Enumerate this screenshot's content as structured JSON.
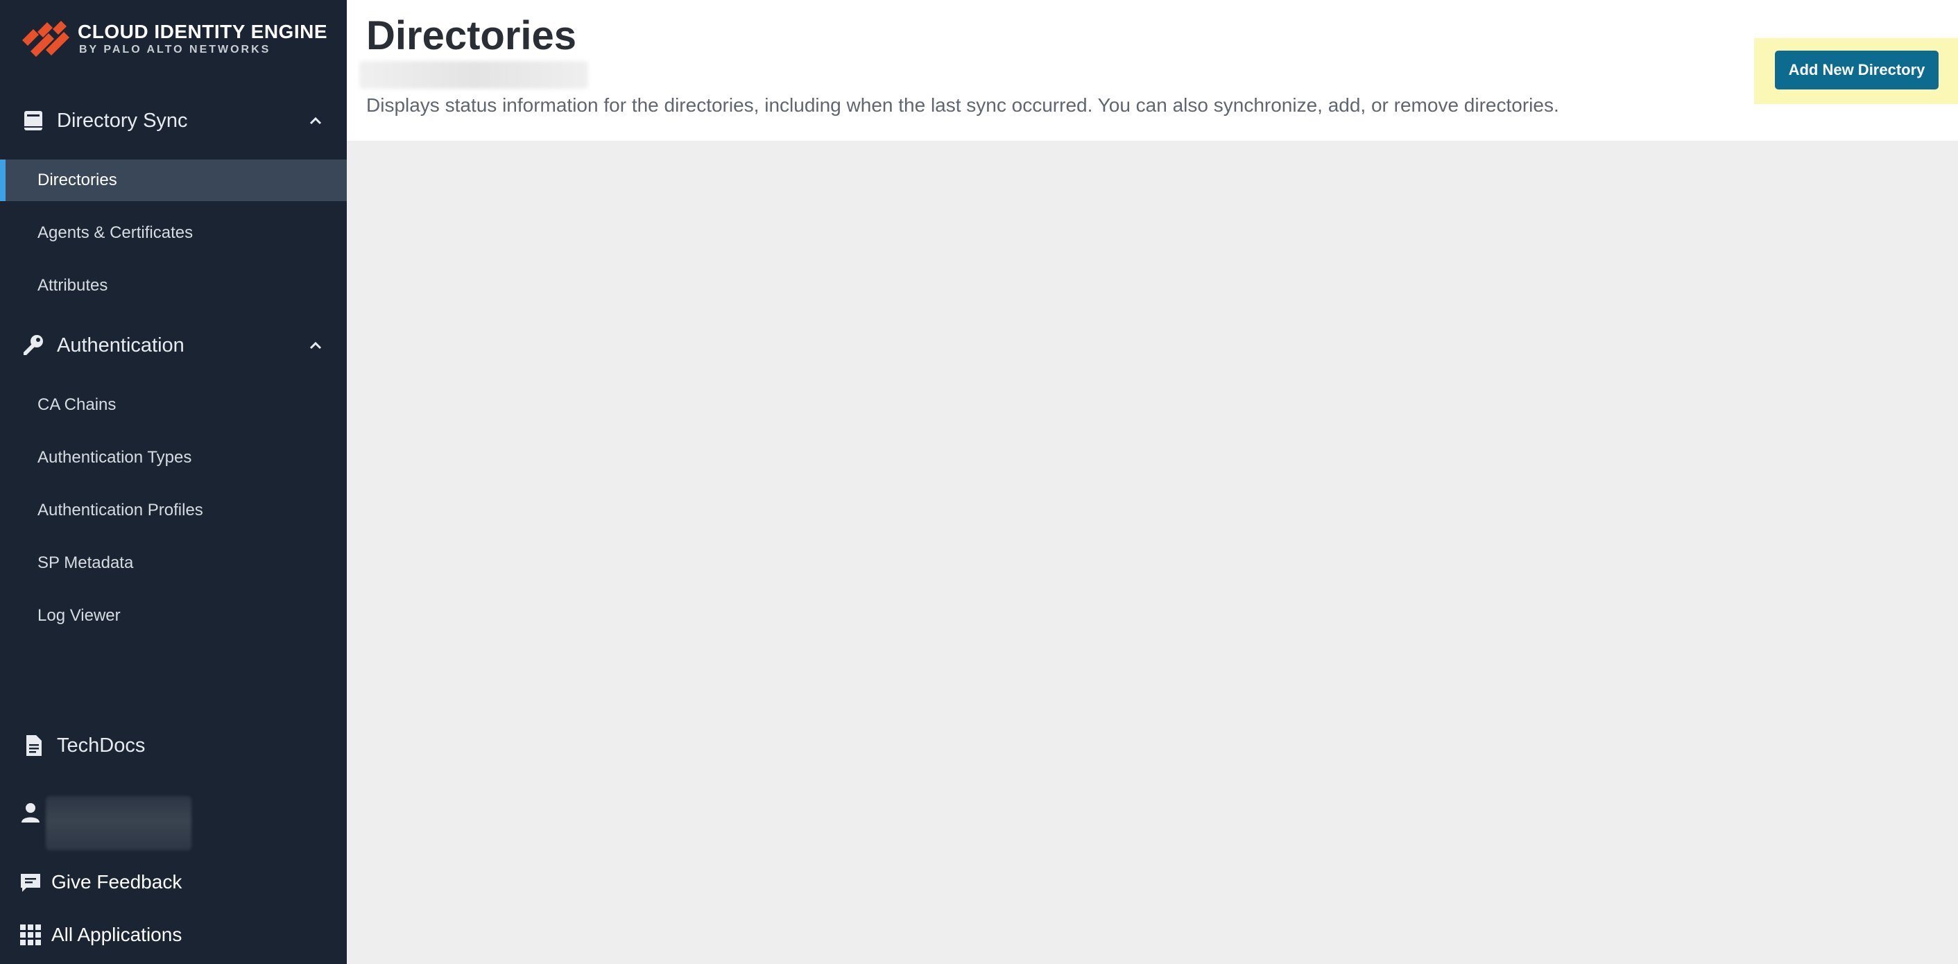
{
  "brand": {
    "title": "CLOUD IDENTITY ENGINE",
    "subtitle": "BY PALO ALTO NETWORKS",
    "logo_color": "#e8512a"
  },
  "sidebar": {
    "sections": [
      {
        "label": "Directory Sync",
        "icon": "book-icon",
        "expanded": true,
        "items": [
          {
            "label": "Directories",
            "active": true
          },
          {
            "label": "Agents & Certificates",
            "active": false
          },
          {
            "label": "Attributes",
            "active": false
          }
        ]
      },
      {
        "label": "Authentication",
        "icon": "key-icon",
        "expanded": true,
        "items": [
          {
            "label": "CA Chains",
            "active": false
          },
          {
            "label": "Authentication Types",
            "active": false
          },
          {
            "label": "Authentication Profiles",
            "active": false
          },
          {
            "label": "SP Metadata",
            "active": false
          },
          {
            "label": "Log Viewer",
            "active": false
          }
        ]
      }
    ],
    "techdocs": {
      "label": "TechDocs",
      "icon": "document-icon"
    },
    "user": {
      "icon": "user-icon"
    },
    "feedback": {
      "label": "Give Feedback",
      "icon": "feedback-icon"
    },
    "all_apps": {
      "label": "All Applications",
      "icon": "grid-icon"
    }
  },
  "main": {
    "title": "Directories",
    "description": "Displays status information for the directories, including when the last sync occurred. You can also synchronize, add, or remove directories.",
    "add_button": "Add New Directory"
  },
  "colors": {
    "sidebar_bg": "#1b2433",
    "active_item_bg": "#3a4758",
    "active_accent": "#3ea1e8",
    "primary_button": "#0c6b8f",
    "button_highlight": "#fbf7b4",
    "content_bg": "#eeeeee"
  }
}
